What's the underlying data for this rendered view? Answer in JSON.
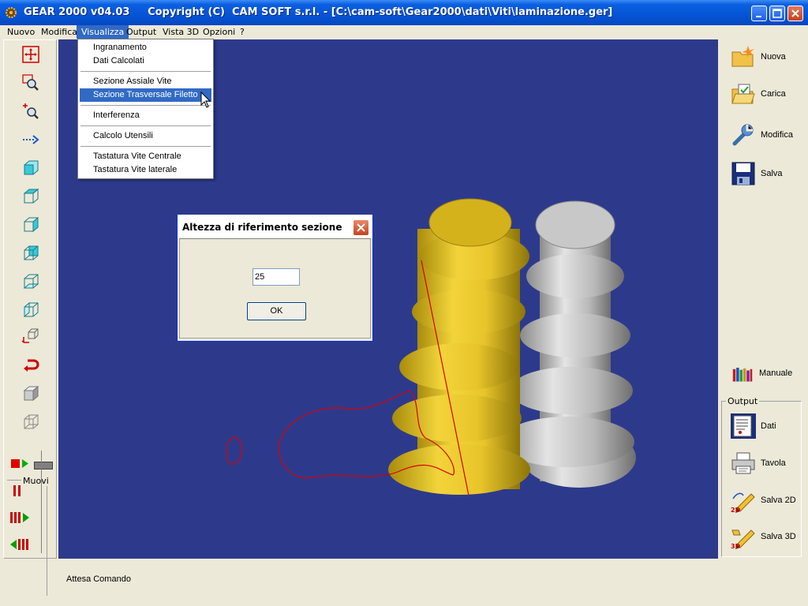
{
  "window": {
    "title": "GEAR 2000 v04.03     Copyright (C)  CAM SOFT s.r.l. - [C:\\cam-soft\\Gear2000\\dati\\Viti\\laminazione.ger]"
  },
  "menubar": {
    "items": [
      "Nuovo",
      "Modifica",
      "Visualizza",
      "Output",
      "Vista 3D",
      "Opzioni",
      "?"
    ],
    "active": "Visualizza"
  },
  "dropdown": {
    "groups": [
      [
        "Ingranamento",
        "Dati Calcolati"
      ],
      [
        "Sezione Assiale Vite",
        "Sezione Trasversale Filetto"
      ],
      [
        "Interferenza"
      ],
      [
        "Calcolo Utensili"
      ],
      [
        "Tastatura Vite Centrale",
        "Tastatura Vite laterale"
      ]
    ],
    "selected": "Sezione Trasversale Filetto"
  },
  "dialog": {
    "title": "Altezza di riferimento sezione",
    "input_value": "25",
    "ok_label": "OK"
  },
  "left_toolbar": {
    "muovi_label": "Muovi"
  },
  "right_toolbar": {
    "buttons": [
      "Nuova",
      "Carica",
      "Modifica",
      "Salva"
    ],
    "manuale": "Manuale",
    "output_label": "Output",
    "output_buttons": [
      "Dati",
      "Tavola",
      "Salva 2D",
      "Salva 3D"
    ]
  },
  "status": {
    "text": "Attesa Comando"
  },
  "colors": {
    "viewport_bg": "#2d3a8c",
    "gold": "#d4b21c",
    "silver": "#b5b5b5",
    "highlight": "#316ac5"
  }
}
